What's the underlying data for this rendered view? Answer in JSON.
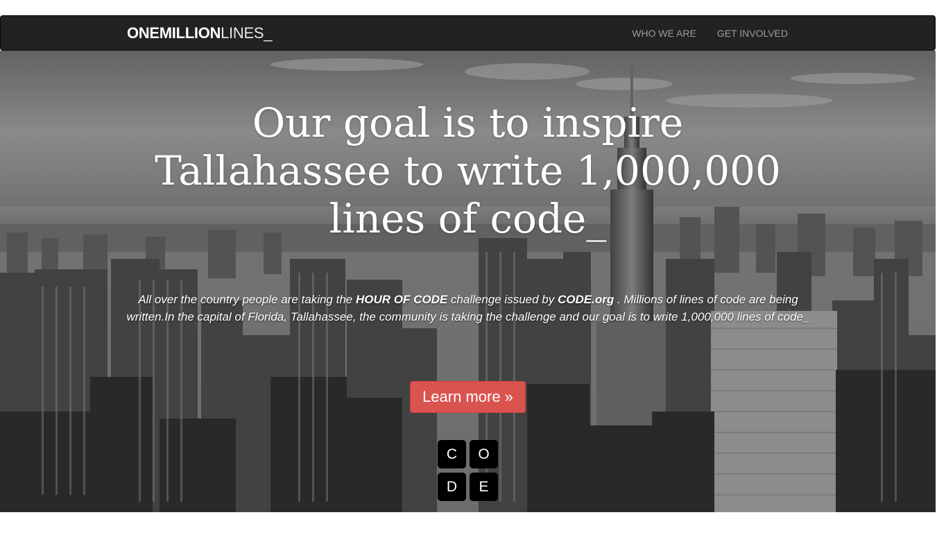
{
  "navbar": {
    "brand_bold": "ONEMILLION",
    "brand_light": "LINES_",
    "links": [
      "WHO WE ARE",
      "GET INVOLVED"
    ]
  },
  "hero": {
    "headline_lines": [
      "Our goal is to inspire",
      "Tallahassee to write 1,000,000",
      "lines of code_"
    ],
    "intro": {
      "part1": "All over the country people are taking the ",
      "strong1": "HOUR OF CODE",
      "part2": " challenge issued by ",
      "strong2": "CODE.org",
      "part3": " . Millions of lines of code are being written.In the capital of Florida, Tallahassee, the community is taking the challenge and our goal is to write 1,000,000 lines of code_"
    },
    "cta_label": "Learn more »",
    "code_logo_letters": [
      "C",
      "O",
      "D",
      "E"
    ]
  },
  "colors": {
    "navbar_bg": "#222222",
    "nav_link": "#9d9d9d",
    "cta_bg": "#d9534f",
    "logo_tile": "#000000"
  }
}
